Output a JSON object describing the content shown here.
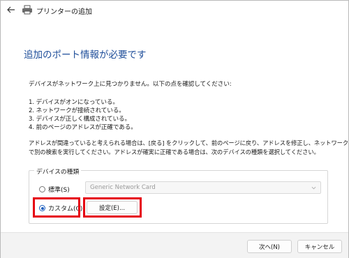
{
  "window": {
    "title": "プリンターの追加",
    "back_icon": "back-arrow-icon",
    "printer_icon": "printer-icon"
  },
  "main": {
    "heading": "追加のポート情報が必要です",
    "intro": "デバイスがネットワーク上に見つかりません。以下の点を確認してください:",
    "checks": [
      "1. デバイスがオンになっている。",
      "2. ネットワークが接続されている。",
      "3. デバイスが正しく構成されている。",
      "4. 前のページのアドレスが正確である。"
    ],
    "note_line1": "アドレスが間違っていると考えられる場合は、[戻る] をクリックして、前のページに戻り、アドレスを修正し、ネットワーク",
    "note_line2": "で別の検索を実行してください。アドレスが確実に正確である場合は、次のデバイスの種類を選択してください。"
  },
  "device_type": {
    "group_label": "デバイスの種類",
    "standard_label": "標準(S)",
    "standard_value": "Generic Network Card",
    "custom_label": "カスタム(C)",
    "settings_button": "設定(E)...",
    "selected": "custom"
  },
  "footer": {
    "next_button": "次へ(N)",
    "cancel_button": "キャンセル"
  },
  "colors": {
    "heading": "#1f4e9a",
    "highlight": "#e60012",
    "radio_selected": "#1f5fbf"
  }
}
